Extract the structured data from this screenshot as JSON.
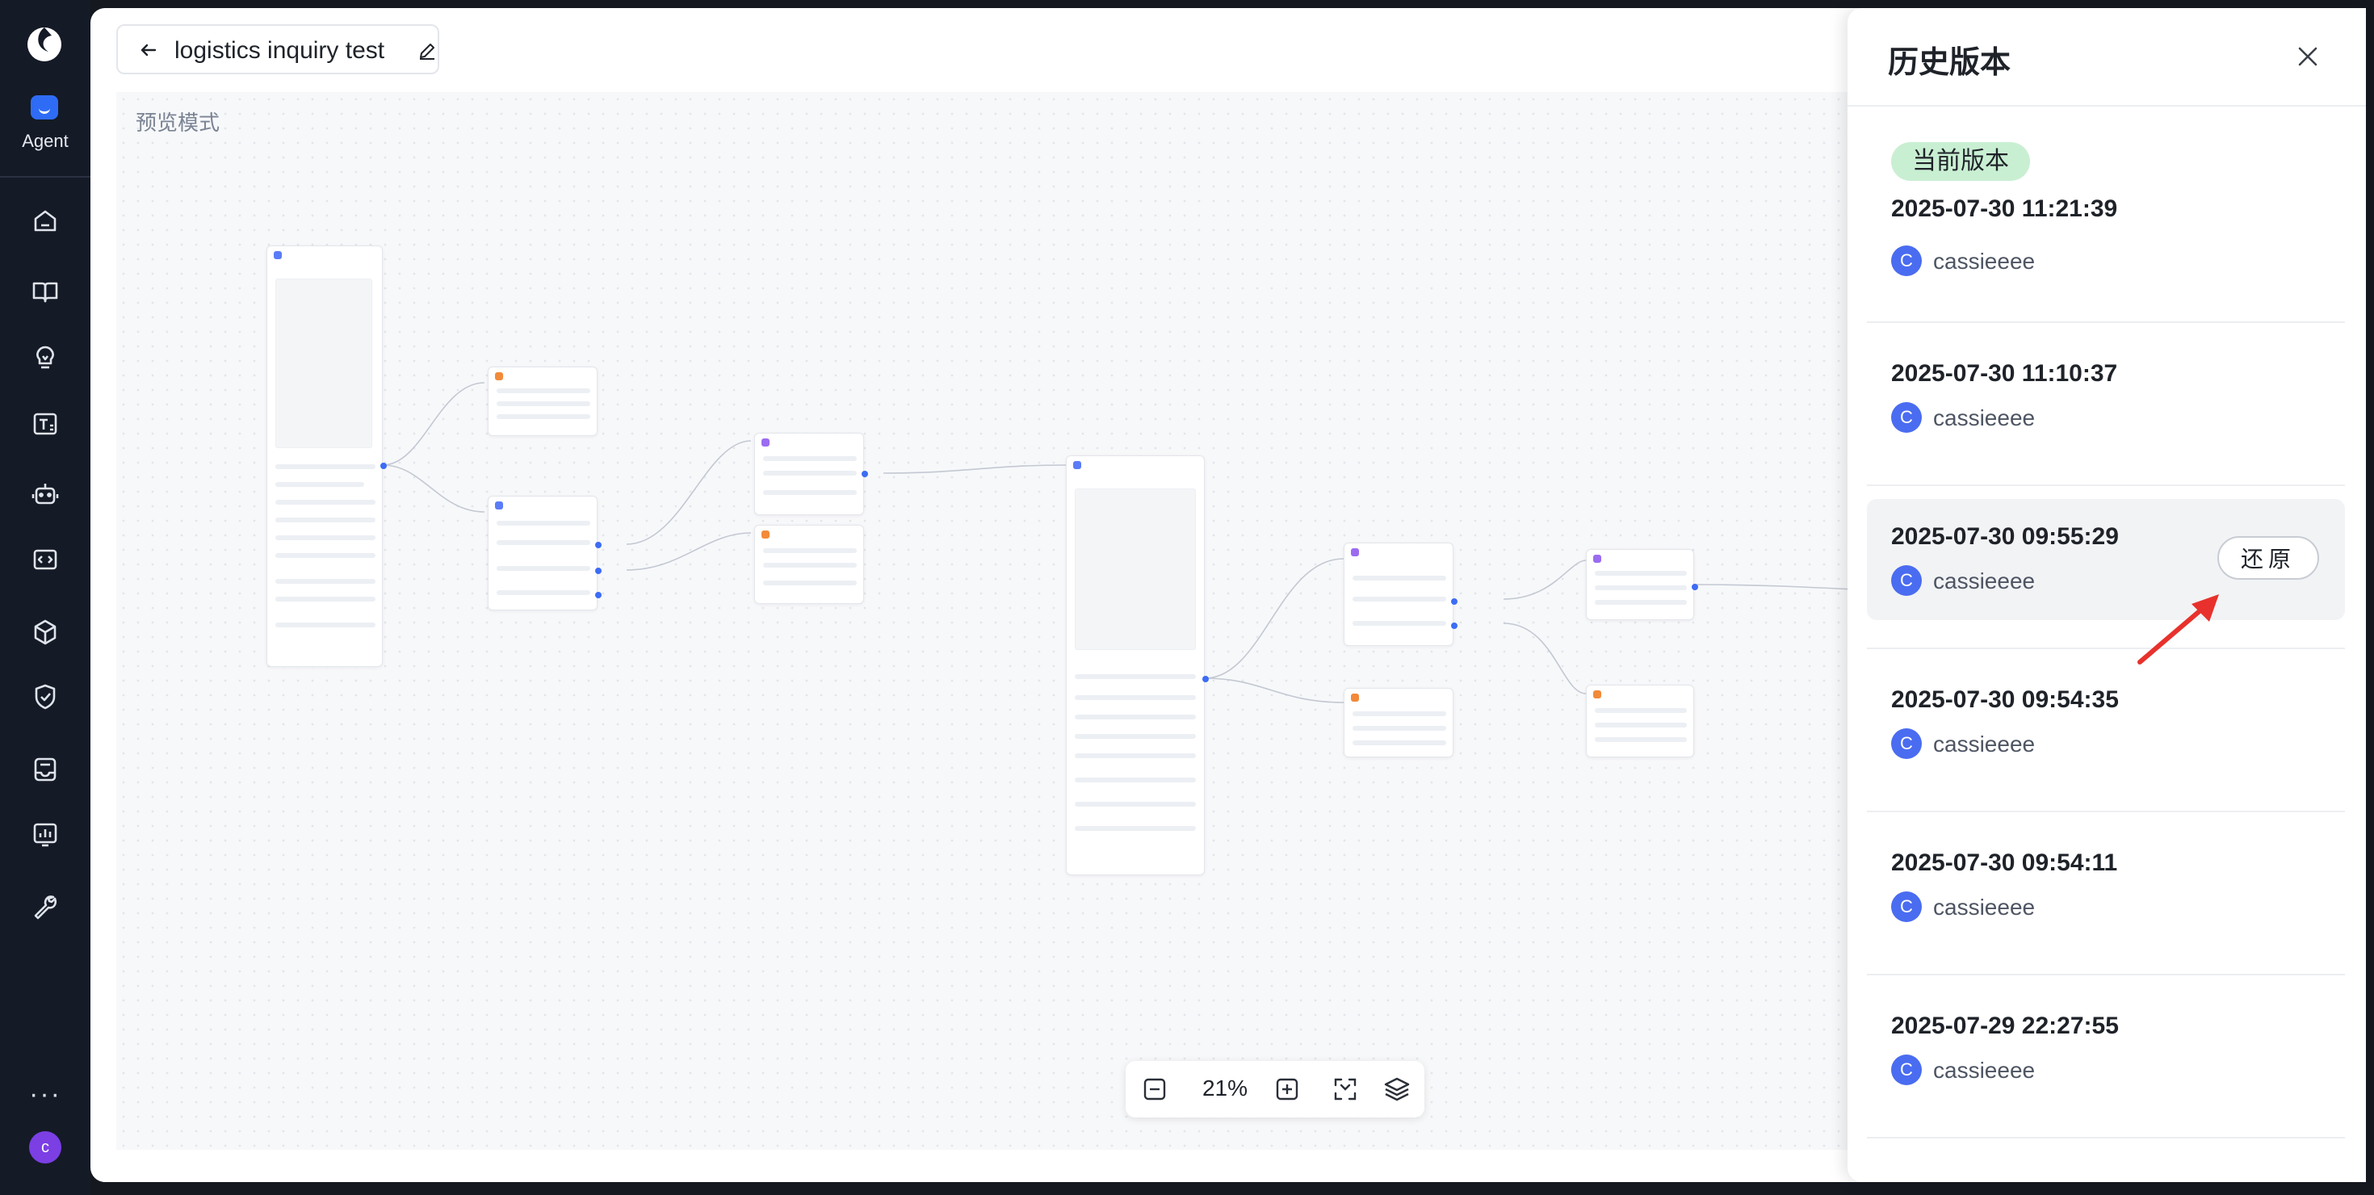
{
  "rail": {
    "agent_label": "Agent",
    "items": [
      "home-icon",
      "book-icon",
      "lightbulb-icon",
      "text-format-icon",
      "robot-icon",
      "code-icon",
      "cube-icon",
      "shield-check-icon",
      "inbox-icon",
      "chart-icon",
      "wrench-icon"
    ],
    "more": "···",
    "user_initial": "c"
  },
  "header": {
    "title": "logistics inquiry test"
  },
  "canvas": {
    "mode_label": "预览模式",
    "zoom": "21%"
  },
  "history": {
    "title": "历史版本",
    "current_badge": "当前版本",
    "restore_label": "还原",
    "versions": [
      {
        "time": "2025-07-30 11:21:39",
        "user": "cassieeee",
        "initial": "C"
      },
      {
        "time": "2025-07-30 11:10:37",
        "user": "cassieeee",
        "initial": "C"
      },
      {
        "time": "2025-07-30 09:55:29",
        "user": "cassieeee",
        "initial": "C"
      },
      {
        "time": "2025-07-30 09:54:35",
        "user": "cassieeee",
        "initial": "C"
      },
      {
        "time": "2025-07-30 09:54:11",
        "user": "cassieeee",
        "initial": "C"
      },
      {
        "time": "2025-07-29 22:27:55",
        "user": "cassieeee",
        "initial": "C"
      }
    ]
  },
  "colors": {
    "rail_bg": "#141a26",
    "accent": "#3d6cf5",
    "badge_bg": "#c9efd2",
    "annotation_arrow": "#e8312c"
  }
}
